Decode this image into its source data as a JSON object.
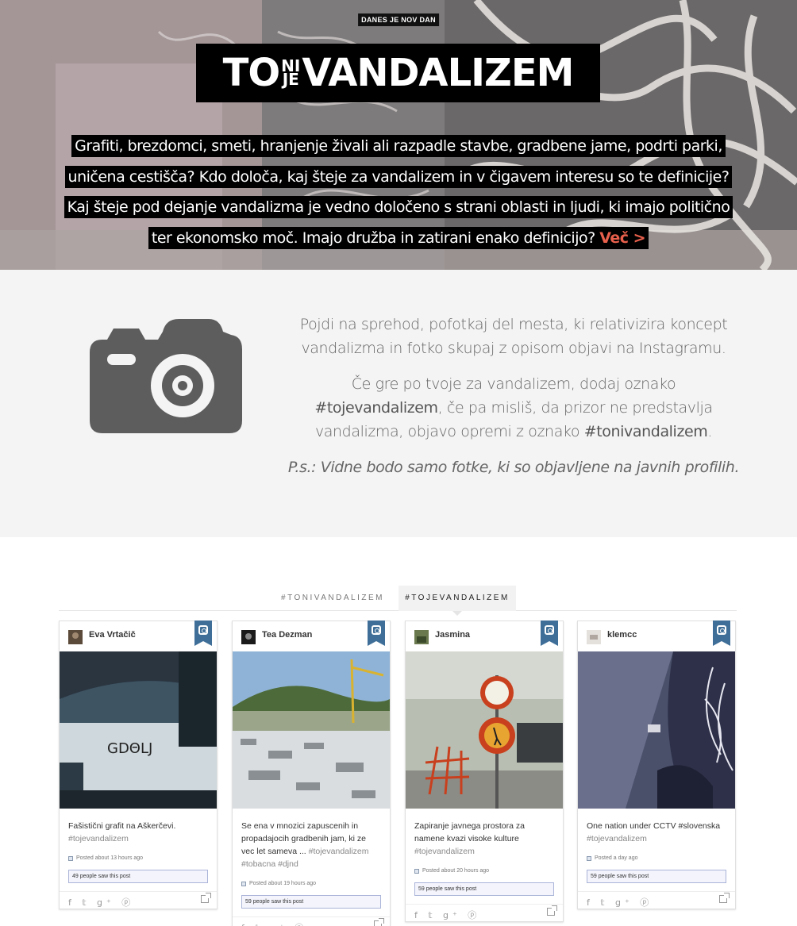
{
  "hero": {
    "kicker": "DANES JE NOV DAN",
    "logo": {
      "left": "TO",
      "top": "NI",
      "bottom": "JE",
      "right": "VANDALIZEM"
    },
    "lines": [
      "Grafiti, brezdomci, smeti, hranjenje živali ali razpadle stavbe, gradbene jame, podrti parki,",
      "uničena cestišča? Kdo določa, kaj šteje za vandalizem in v čigavem interesu so te definicije?",
      "Kaj šteje pod dejanje vandalizma je vedno določeno s strani oblasti in ljudi, ki imajo politično",
      "ter ekonomsko moč. Imajo družba in zatirani enako definicijo?"
    ],
    "more_label": "Več >"
  },
  "info": {
    "icon": "camera-icon",
    "p1": "Pojdi na sprehod, pofotkaj del mesta, ki relativizira koncept vandalizma in fotko skupaj z opisom objavi na Instagramu.",
    "p2_a": "Če gre po tvoje za vandalizem, dodaj oznako ",
    "p2_tag1": "#tojevandalizem",
    "p2_b": ", če pa misliš, da prizor ne predstavlja vandalizma, objavo opremi z oznako ",
    "p2_tag2": "#tonivandalizem",
    "p2_c": ".",
    "ps": "P.s.: Vidne bodo samo fotke, ki so objavljene na javnih profilih."
  },
  "tabs": [
    {
      "label": "#TONIVANDALIZEM",
      "active": false
    },
    {
      "label": "#TOJEVANDALIZEM",
      "active": true
    }
  ],
  "cards": [
    {
      "user": "Eva Vrtačič",
      "caption": "Fašistični grafit na Aškerčevi.",
      "tags": "#tojevandalizem",
      "posted": "Posted about 13 hours ago",
      "saw": "49 people saw this post"
    },
    {
      "user": "Tea Dezman",
      "caption": "Se ena v mnozici zapuscenih in propadajocih gradbenih jam, ki ze vec let sameva ...",
      "tags": "#tojevandalizem #tobacna #djnd",
      "posted": "Posted about 19 hours ago",
      "saw": "59 people saw this post"
    },
    {
      "user": "Jasmina",
      "caption": "Zapiranje javnega prostora za namene kvazi visoke kulture",
      "tags": "#tojevandalizem",
      "posted": "Posted about 20 hours ago",
      "saw": "59 people saw this post"
    },
    {
      "user": "klemcc",
      "caption": "One nation under CCTV #slovenska",
      "tags": "#tojevandalizem",
      "posted": "Posted a day ago",
      "saw": "59 people saw this post"
    }
  ],
  "card_image_text": "GDΘLJ",
  "social_icons": [
    "facebook-icon",
    "twitter-icon",
    "google-plus-icon",
    "pinterest-icon"
  ],
  "colors": {
    "accent": "#e8604c",
    "ribbon": "#3f6f98",
    "info_bg": "#f4f4f4"
  }
}
